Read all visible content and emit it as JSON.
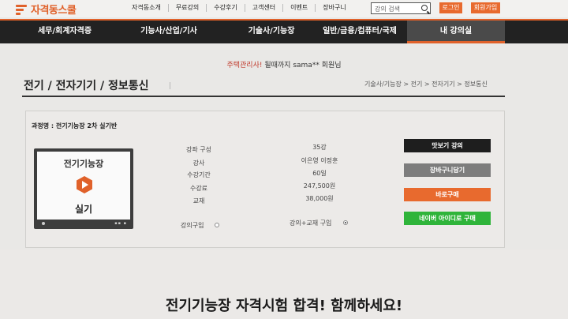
{
  "brand": {
    "name": "자격동스쿨",
    "accent": "#e0612a"
  },
  "util_nav": [
    "자격동소개",
    "무료강의",
    "수강후기",
    "고객센터",
    "이벤트",
    "장바구니"
  ],
  "search": {
    "placeholder": "강의 검색"
  },
  "auth": {
    "login": "로그인",
    "join": "회원가입"
  },
  "main_nav": [
    {
      "label": "세무/회계자격증",
      "active": false
    },
    {
      "label": "기능사/산업/기사",
      "active": false
    },
    {
      "label": "기술사/기능장",
      "active": false
    },
    {
      "label": "일반/금융/컴퓨터/국제",
      "active": false
    },
    {
      "label": "내 강의실",
      "active": true
    }
  ],
  "greeting": {
    "highlight": "주택관리사!",
    "rest": " 될때까지 sama** 회원님"
  },
  "page": {
    "title": "전기 / 전자기기 / 정보통신",
    "title_cursor": "|",
    "breadcrumb": "기술사/기능장 > 전기 > 전자기기 > 정보통신"
  },
  "course": {
    "name_line": "과정명 : 전기기능장 2차 실기반",
    "thumb_title": "전기기능장",
    "thumb_sub": "실기",
    "thumb_controls": "▪▪ ▪",
    "info": [
      {
        "label": "강좌 구성",
        "value": "35강"
      },
      {
        "label": "강사",
        "value": "이은영 이정훈"
      },
      {
        "label": "수강기간",
        "value": "60일"
      },
      {
        "label": "수강료",
        "value": "247,500원"
      },
      {
        "label": "교재",
        "value": "38,000원"
      }
    ],
    "purchase_options": [
      {
        "label": "강의구입",
        "checked": false
      },
      {
        "label": "강의+교재 구입",
        "checked": true
      }
    ]
  },
  "actions": [
    {
      "label": "맛보기 강의",
      "color": "#1e1e1e"
    },
    {
      "label": "장바구니담기",
      "color": "#7d7d7d"
    },
    {
      "label": "바로구매",
      "color": "#e86a2e"
    },
    {
      "label": "네이버 아이디로 구매",
      "color": "#2fb43a"
    }
  ],
  "headline": "전기기능장 자격시험 합격! 함께하세요!"
}
